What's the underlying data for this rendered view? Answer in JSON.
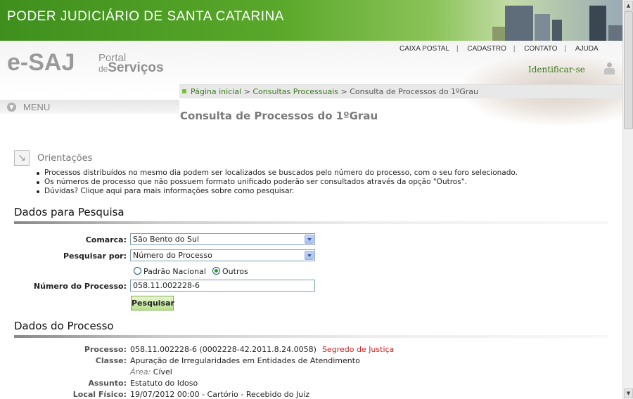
{
  "banner": {
    "title": "PODER JUDICIÁRIO DE SANTA CATARINA"
  },
  "logo": {
    "esaj": "e-SAJ",
    "portal": "Portal",
    "de": "de",
    "servicos": "Serviços"
  },
  "topnav": {
    "items": [
      "CAIXA POSTAL",
      "CADASTRO",
      "CONTATO",
      "AJUDA"
    ],
    "separator": "|"
  },
  "identificar": "Identificar-se",
  "breadcrumb": {
    "home": "Página inicial",
    "sep": ">",
    "consultas": "Consultas Processuais",
    "current": "Consulta de Processos do 1ºGrau"
  },
  "menu": {
    "label": "MENU"
  },
  "page_title": "Consulta de Processos do 1ºGrau",
  "orientacoes": {
    "label": "Orientações",
    "items": [
      "Processos distribuídos no mesmo dia podem ser localizados se buscados pelo número do processo, com o seu foro selecionado.",
      "Os números de processo que não possuem formato unificado poderão ser consultados através da opção \"Outros\".",
      "Dúvidas? Clique aqui para mais informações sobre como pesquisar."
    ]
  },
  "search": {
    "section_title": "Dados para Pesquisa",
    "comarca_label": "Comarca:",
    "comarca_value": "São Bento do Sul",
    "pesquisar_por_label": "Pesquisar por:",
    "pesquisar_por_value": "Número do Processo",
    "radio_padrao": "Padrão Nacional",
    "radio_outros": "Outros",
    "radio_selected": "Outros",
    "numero_label": "Número do Processo:",
    "numero_value": "058.11.002228-6",
    "button": "Pesquisar"
  },
  "processo": {
    "section_title": "Dados do Processo",
    "processo_label": "Processo:",
    "processo_value": "058.11.002228-6 (0002228-42.2011.8.24.0058)",
    "segredo": "Segredo de Justiça",
    "classe_label": "Classe:",
    "classe_value": "Apuração de Irregularidades em Entidades de Atendimento",
    "area_label": "Área:",
    "area_value": "Cível",
    "assunto_label": "Assunto:",
    "assunto_value": "Estatuto do Idoso",
    "local_label": "Local Físico:",
    "local_value": "19/07/2012 00:00 - Cartório - Recebido do Juiz"
  },
  "colors": {
    "green_link": "#3a7a1c",
    "secret_red": "#d41c1c",
    "banner_green": "#4a9a22"
  }
}
